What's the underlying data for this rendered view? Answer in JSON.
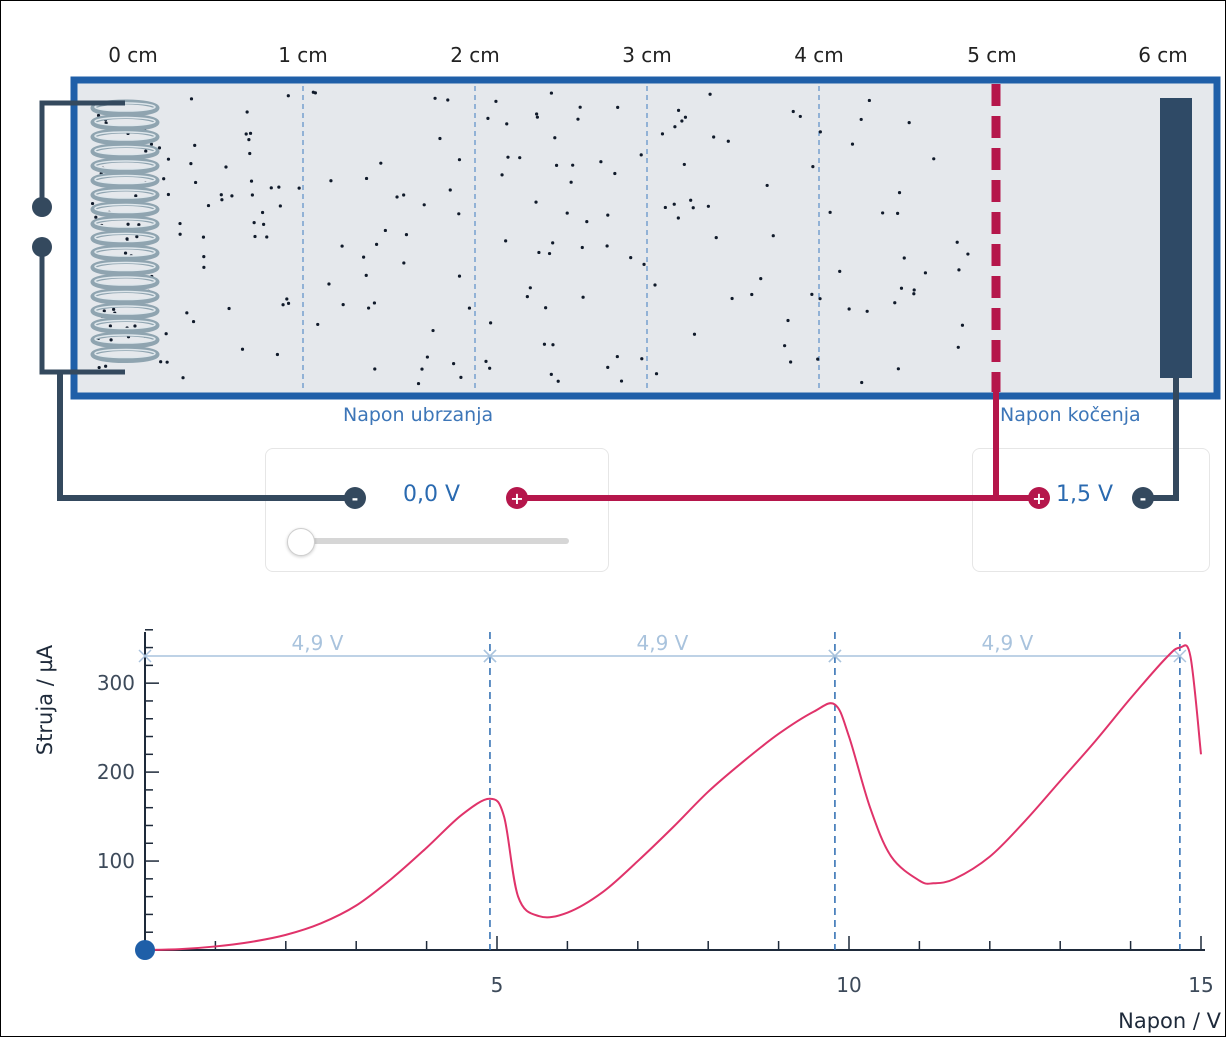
{
  "ruler": {
    "labels": [
      "0 cm",
      "1 cm",
      "2 cm",
      "3 cm",
      "4 cm",
      "5 cm",
      "6 cm"
    ]
  },
  "apparatus": {
    "accelerating_label": "Napon ubrzanja",
    "braking_label": "Napon kočenja",
    "accelerating_voltage": "0,0 V",
    "braking_voltage": "1,5 V",
    "accelerating_slider_fraction": 0.0,
    "plus_symbol": "+",
    "minus_symbol": "-",
    "colors": {
      "tube_border": "#1f5fa8",
      "tube_fill": "#e5e8ec",
      "cathode_wire": "#34495e",
      "grid_wire": "#b5164b",
      "anode": "#2f4a66",
      "field_lines": "#3f7cc0"
    }
  },
  "chart_data": {
    "type": "line",
    "xlabel": "Napon / V",
    "ylabel": "Struja / µA",
    "xlim": [
      0,
      15
    ],
    "ylim": [
      0,
      380
    ],
    "x_ticks": [
      5,
      10,
      15
    ],
    "y_ticks": [
      100,
      200,
      300
    ],
    "series": [
      {
        "color": "#e0336a",
        "x": [
          0,
          0.5,
          1,
          1.5,
          2,
          2.5,
          3,
          3.5,
          4,
          4.5,
          4.9,
          5.1,
          5.3,
          5.6,
          6.0,
          6.5,
          7,
          7.5,
          8,
          8.5,
          9,
          9.5,
          9.8,
          10.0,
          10.3,
          10.6,
          11.0,
          11.2,
          11.5,
          12,
          12.5,
          13,
          13.5,
          14,
          14.5,
          14.7,
          14.85,
          15.0
        ],
        "y": [
          0,
          1,
          4,
          9,
          17,
          30,
          50,
          80,
          115,
          152,
          170,
          150,
          60,
          38,
          42,
          65,
          100,
          138,
          178,
          212,
          243,
          268,
          276,
          240,
          160,
          105,
          78,
          75,
          80,
          105,
          145,
          190,
          235,
          283,
          328,
          340,
          330,
          220
        ]
      }
    ],
    "peak_markers": [
      4.9,
      9.8,
      14.7
    ],
    "spacing_labels": [
      "4,9 V",
      "4,9 V",
      "4,9 V"
    ],
    "current_point": {
      "x": 0,
      "y": 0
    }
  }
}
